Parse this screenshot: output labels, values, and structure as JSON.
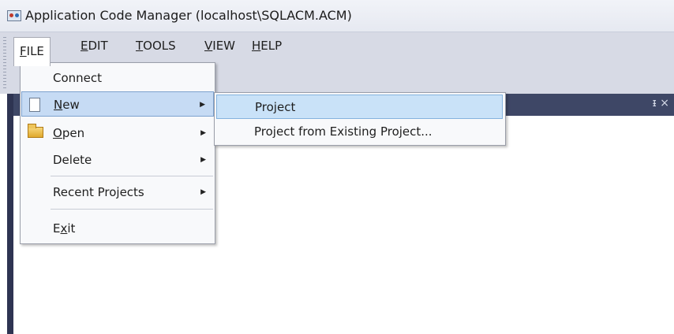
{
  "window": {
    "title": "Application Code Manager (localhost\\SQLACM.ACM)"
  },
  "menubar": [
    {
      "label": "FILE",
      "mnemonic": "F",
      "rest": "ILE"
    },
    {
      "label": "EDIT",
      "mnemonic": "E",
      "rest": "DIT"
    },
    {
      "label": "TOOLS",
      "mnemonic": "T",
      "rest": "OOLS"
    },
    {
      "label": "VIEW",
      "mnemonic": "V",
      "rest": "IEW"
    },
    {
      "label": "HELP",
      "mnemonic": "H",
      "rest": "ELP"
    }
  ],
  "file_menu": {
    "connect": {
      "label": "Connect"
    },
    "new": {
      "mnemonic": "N",
      "rest": "ew",
      "icon": "new-document-icon"
    },
    "open": {
      "mnemonic": "O",
      "rest": "pen",
      "icon": "open-folder-icon"
    },
    "delete": {
      "label": "Delete"
    },
    "recent": {
      "label": "Recent Projects"
    },
    "exit": {
      "before": "E",
      "mnemonic": "x",
      "rest": "it"
    }
  },
  "new_submenu": [
    {
      "label": "Project"
    },
    {
      "label": "Project from Existing Project..."
    }
  ],
  "panel": {
    "pin_glyph": "ᵻ",
    "close_glyph": "×"
  },
  "colors": {
    "panel_header": "#3e4766",
    "menubar": "#d7dae5",
    "highlight": "#c6dbf4"
  }
}
